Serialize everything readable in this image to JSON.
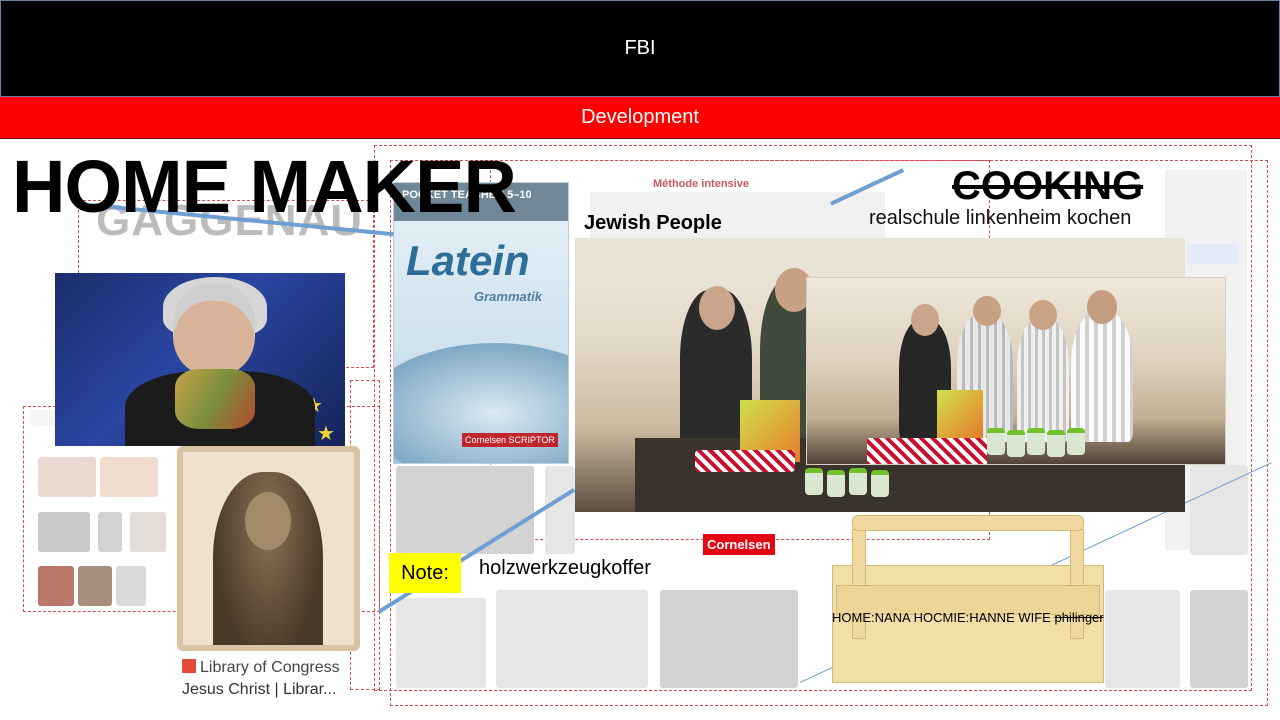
{
  "header": {
    "title": "FBI"
  },
  "banner": {
    "label": "Development"
  },
  "heading": {
    "home_maker": "HOME MAKER",
    "gaggenau": "GAGGENAU"
  },
  "cooking": {
    "title": "COOKING",
    "subtitle": "realschule linkenheim kochen"
  },
  "jewish": {
    "label": "Jewish People"
  },
  "latin_book": {
    "strip": "POCKET TEACHER 5–10",
    "title": "Latein",
    "subtitle": "Grammatik",
    "badge": "Cornelsen SCRIPTOR"
  },
  "methode": {
    "label": "Méthode intensive"
  },
  "cornelsen": {
    "label": "Cornelsen"
  },
  "note": {
    "badge": "Note:",
    "text": "holzwerkzeugkoffer"
  },
  "wife_line": {
    "text": "HOME:NANA HOCMIE:HANNE WIFE ",
    "struck": "philinger"
  },
  "library_caption": {
    "source": "Library of Congress",
    "title": "Jesus Christ | Librar..."
  },
  "colors": {
    "header_bg": "#000000",
    "banner_bg": "#ff0000",
    "note_bg": "#ffff00",
    "accent_line": "#6e9fd3"
  },
  "icons": [
    "library-of-congress-icon"
  ]
}
